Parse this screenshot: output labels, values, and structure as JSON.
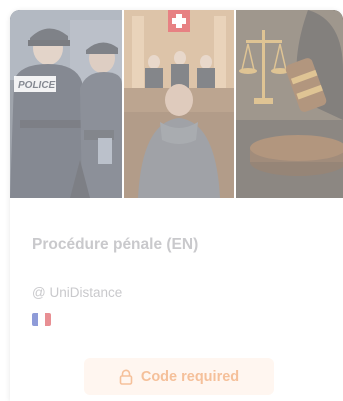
{
  "course": {
    "title": "Procédure pénale (EN)",
    "provider": "@ UniDistance",
    "language_flag": {
      "name": "flag-france-icon",
      "colors": [
        "#8e9bd8",
        "#ffffff",
        "#e88f93"
      ]
    }
  },
  "access": {
    "button_label": "Code required",
    "icon": "lock-icon",
    "accent_color": "#f5c09a"
  },
  "hero": {
    "images": [
      "police-arrest-image",
      "courtroom-image",
      "gavel-scales-image"
    ]
  }
}
